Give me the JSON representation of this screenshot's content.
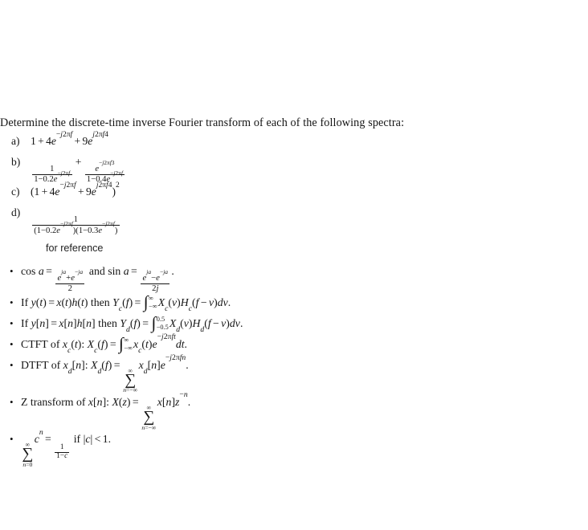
{
  "document": {
    "prompt": "Determine the discrete-time inverse Fourier transform of each of the following spectra:",
    "reference_heading": "for reference",
    "problems": [
      {
        "label": "a)",
        "latex": "1 + 4e^{-j2\\pi f} + 9e^{j2\\pi f4}",
        "plain": "1 + 4e^(-j2πf) + 9e^(j2πf4)"
      },
      {
        "label": "b)",
        "latex": "\\frac{1}{1-0.2e^{-j2\\pi f}} + \\frac{e^{-j2\\pi f3}}{1-0.4e^{-j2\\pi f}}",
        "plain": "1/(1-0.2e^(-j2πf)) + e^(-j2πf3)/(1-0.4e^(-j2πf))"
      },
      {
        "label": "c)",
        "latex": "(1 + 4e^{-j2\\pi f} + 9e^{j2\\pi f4})^2",
        "plain": "(1 + 4e^(-j2πf) + 9e^(j2πf4))^2"
      },
      {
        "label": "d)",
        "latex": "\\frac{1}{(1-0.2e^{-j2\\pi f})(1-0.3e^{-j2\\pi f})}",
        "plain": "1/((1-0.2e^(-j2πf))(1-0.3e^(-j2πf)))"
      }
    ],
    "reference_items": [
      {
        "id": "euler-cos-sin",
        "latex": "\\cos a = \\frac{e^{ja}+e^{-ja}}{2} \\text{ and } \\sin a = \\frac{e^{ja}-e^{-ja}}{2j}.",
        "plain": "cos a = (e^(ja)+e^(-ja))/2 and sin a = (e^(ja)-e^(-ja))/(2j)."
      },
      {
        "id": "continuous-multiplication-convolution",
        "latex": "\\text{If } y(t) = x(t)h(t) \\text{ then } Y_c(f) = \\int_{-\\infty}^{\\infty} X_c(v)H_c(f-v)dv.",
        "plain": "If y(t) = x(t)h(t) then Yc(f) = integral from -inf to inf of Xc(v)Hc(f - v)dv."
      },
      {
        "id": "discrete-multiplication-convolution",
        "latex": "\\text{If } y[n] = x[n]h[n] \\text{ then } Y_d(f) = \\int_{-0.5}^{0.5} X_d(v)H_d(f-v)dv.",
        "plain": "If y[n] = x[n]h[n] then Yd(f) = integral from -0.5 to 0.5 of Xd(v)Hd(f - v)dv."
      },
      {
        "id": "ctft-definition",
        "latex": "\\text{CTFT of } x_c(t): X_c(f) = \\int_{-\\infty}^{\\infty} x_c(t)e^{-j2\\pi ft}dt.",
        "plain": "CTFT of xc(t): Xc(f) = integral from -inf to inf of xc(t)e^(-j2πft)dt."
      },
      {
        "id": "dtft-definition",
        "latex": "\\text{DTFT of } x_d[n]: X_d(f) = \\sum_{n=-\\infty}^{\\infty} x_d[n]e^{-j2\\pi fn}.",
        "plain": "DTFT of xd[n]: Xd(f) = sum n=-inf to inf of xd[n]e^(-j2πfn)."
      },
      {
        "id": "z-transform-definition",
        "latex": "\\text{Z transform of } x[n]: X(z) = \\sum_{n=-\\infty}^{\\infty} x[n]z^{-n}.",
        "plain": "Z transform of x[n]: X(z) = sum n=-inf to inf of x[n]z^(-n)."
      },
      {
        "id": "geometric-series",
        "latex": "\\sum_{n=0}^{\\infty} c^n = \\frac{1}{1-c} \\text{ if } |c| < 1.",
        "plain": "sum n=0 to inf of c^n = 1/(1-c) if |c| < 1."
      }
    ],
    "labels": {
      "a": "a)",
      "b": "b)",
      "c": "c)",
      "d": "d)"
    },
    "symbols": {
      "bullet": "•",
      "infinity": "∞",
      "pi": "π",
      "sum": "∑",
      "integral": "∫",
      "minus": "−",
      "plus": "+",
      "equals": "=",
      "less_than": "<"
    },
    "colors": {
      "background": "#ffffff",
      "text": "#151515",
      "heading_text": "#222222"
    }
  }
}
